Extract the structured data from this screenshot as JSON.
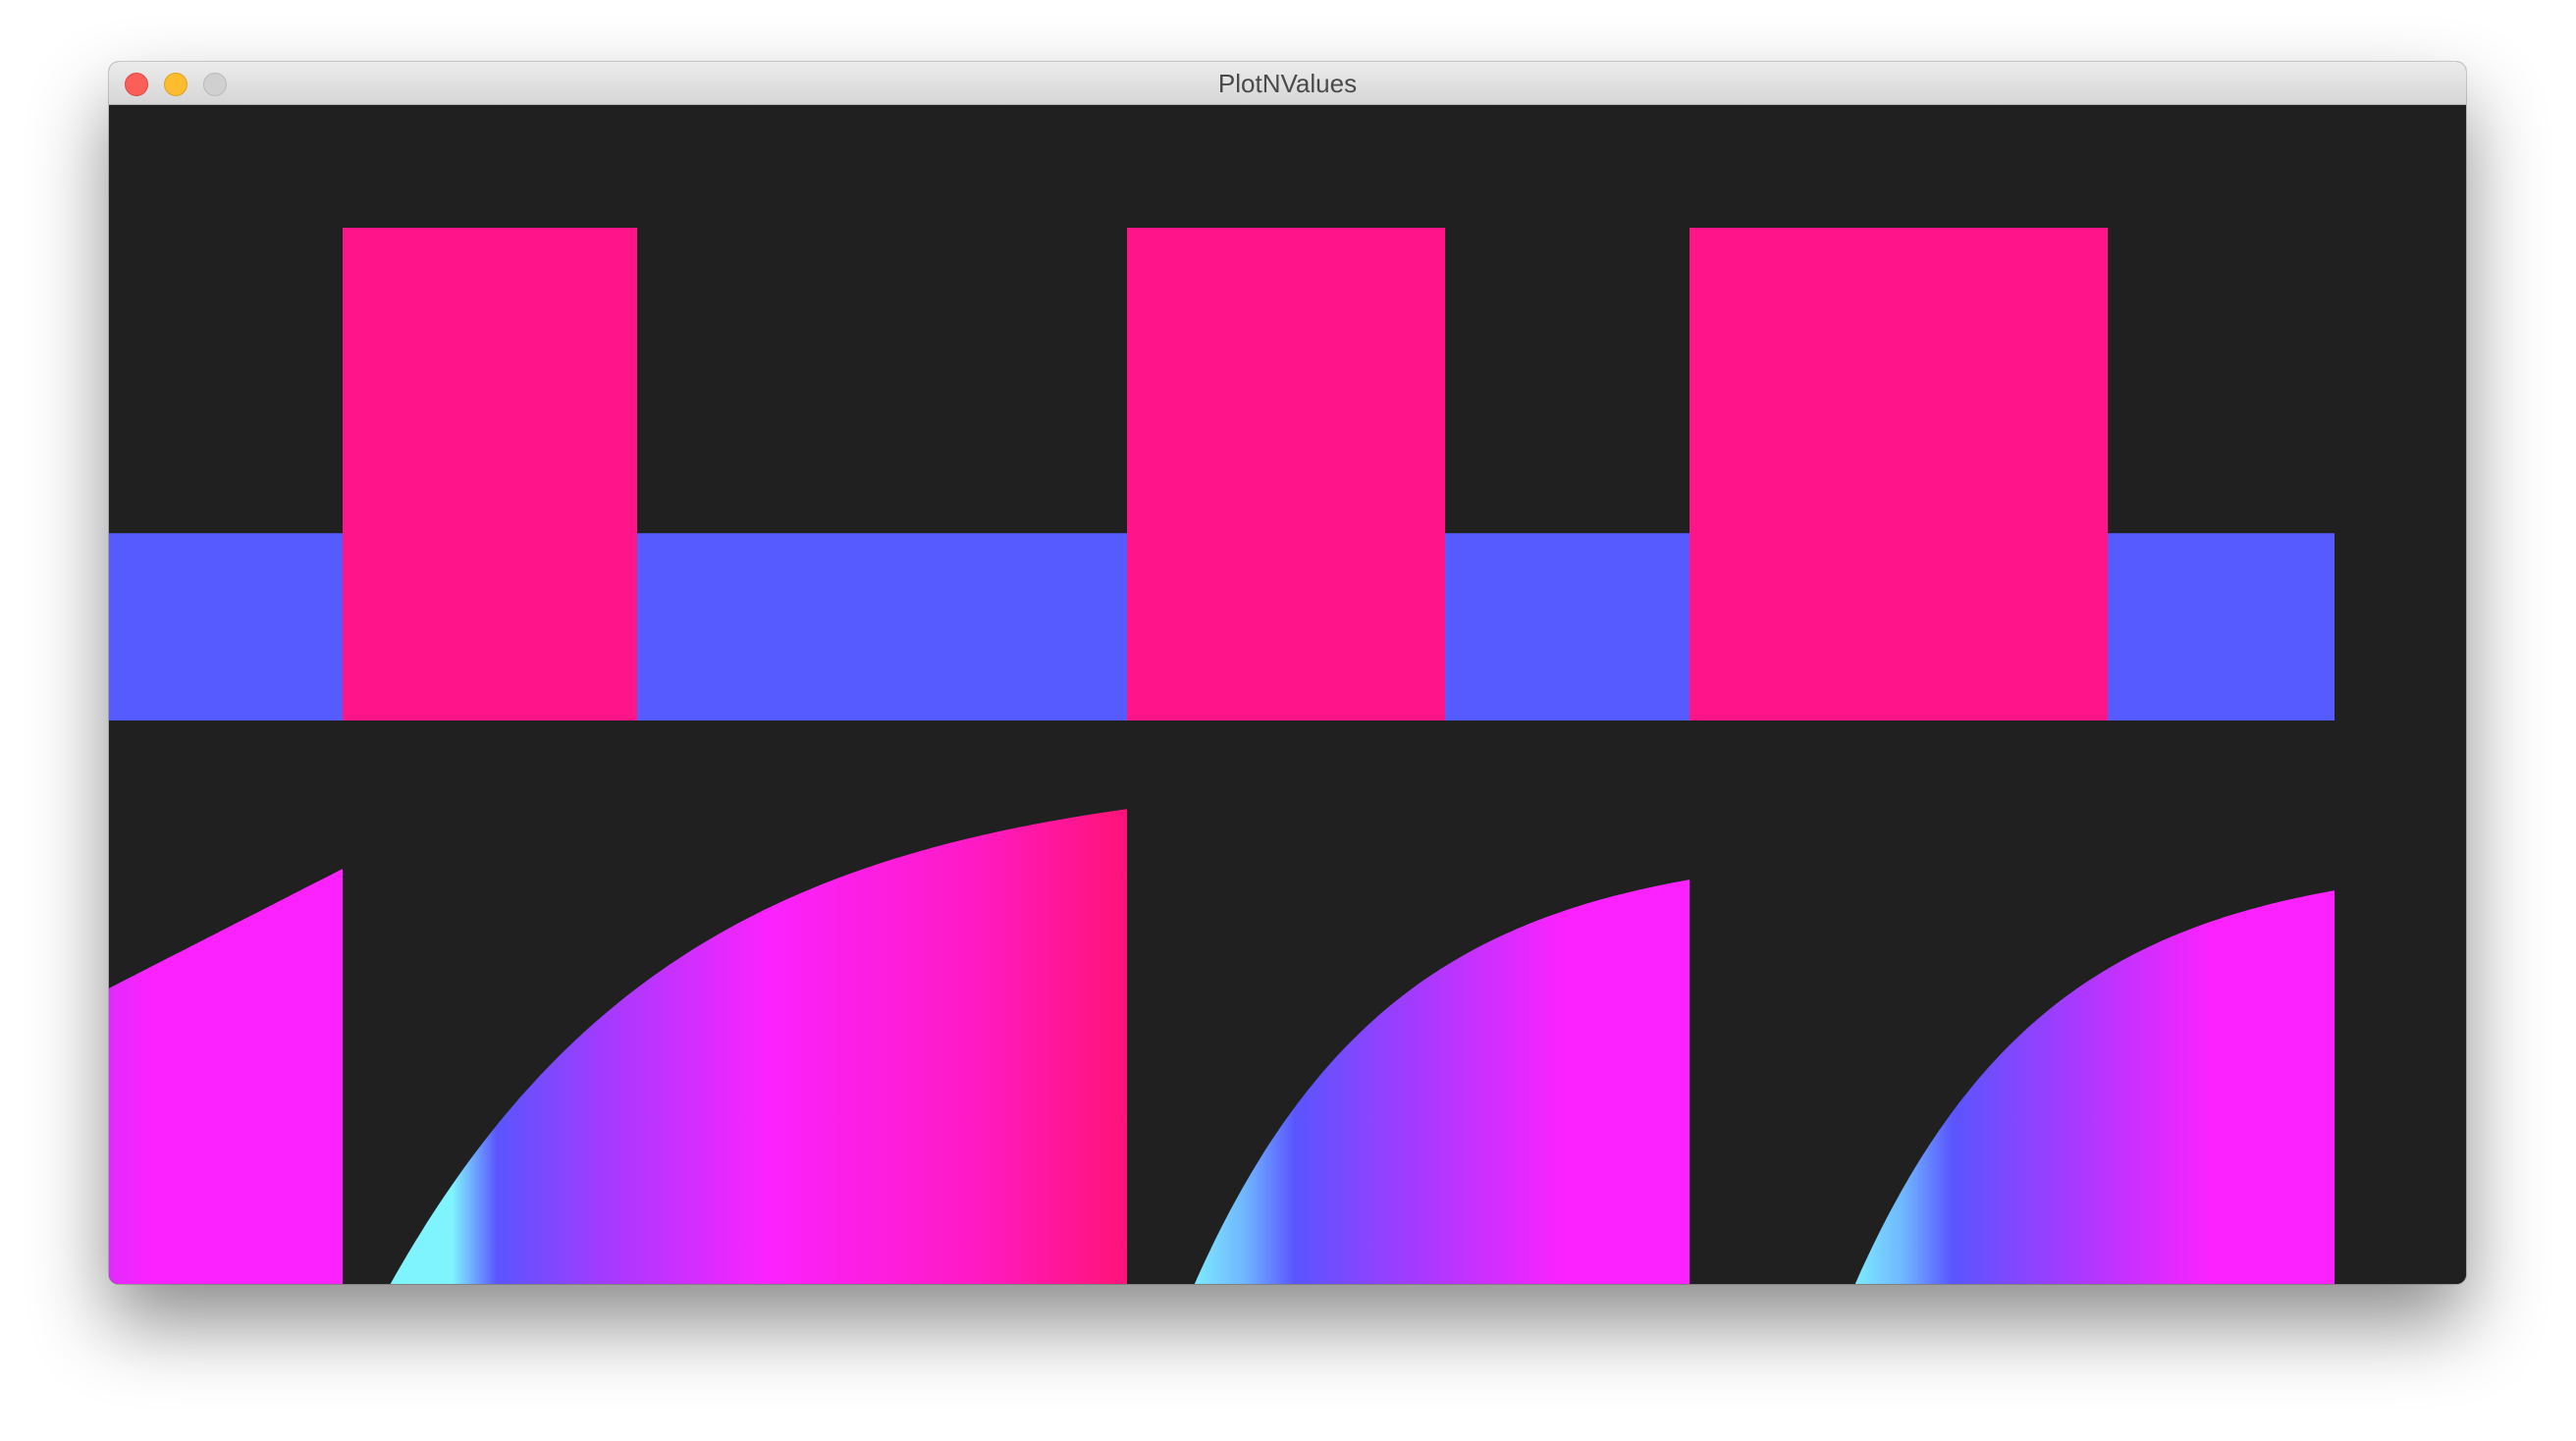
{
  "window": {
    "title": "PlotNValues"
  },
  "colors": {
    "background": "#202020",
    "gate": "#ff1589",
    "base": "#555bff",
    "ramp_low": "#7ff4ff",
    "ramp_mid": "#5a55ff",
    "ramp_high": "#fb22ff",
    "ramp_peak": "#ff1377"
  },
  "chart_data": [
    {
      "type": "area",
      "description_series": "gate",
      "x_max": 2401,
      "y_range": [
        0,
        1
      ],
      "series": [
        {
          "segments": [
            {
              "x0": 0,
              "x1": 238,
              "value": 0.38
            },
            {
              "x0": 238,
              "x1": 538,
              "value": 1.0
            },
            {
              "x0": 538,
              "x1": 1037,
              "value": 0.38
            },
            {
              "x0": 1037,
              "x1": 1361,
              "value": 1.0
            },
            {
              "x0": 1361,
              "x1": 1610,
              "value": 0.38
            },
            {
              "x0": 1610,
              "x1": 2036,
              "value": 1.0
            },
            {
              "x0": 2036,
              "x1": 2267,
              "value": 0.38
            }
          ]
        }
      ]
    },
    {
      "type": "area",
      "description_series": "envelope",
      "x_max": 2401,
      "y_range": [
        0,
        1
      ],
      "series": [
        {
          "segments": [
            {
              "x0": 0,
              "x1": 238,
              "start": 0.59,
              "end": 0.81,
              "shape": "linear"
            },
            {
              "x0": 238,
              "x1": 1037,
              "start": 0.0,
              "end": 0.92,
              "shape": "exp",
              "rise_offset": 35
            },
            {
              "x0": 1037,
              "x1": 1610,
              "start": 0.0,
              "end": 0.79,
              "shape": "exp",
              "rise_offset": 58
            },
            {
              "x0": 1610,
              "x1": 2267,
              "start": 0.0,
              "end": 0.77,
              "shape": "exp",
              "rise_offset": 158
            }
          ]
        }
      ]
    }
  ]
}
